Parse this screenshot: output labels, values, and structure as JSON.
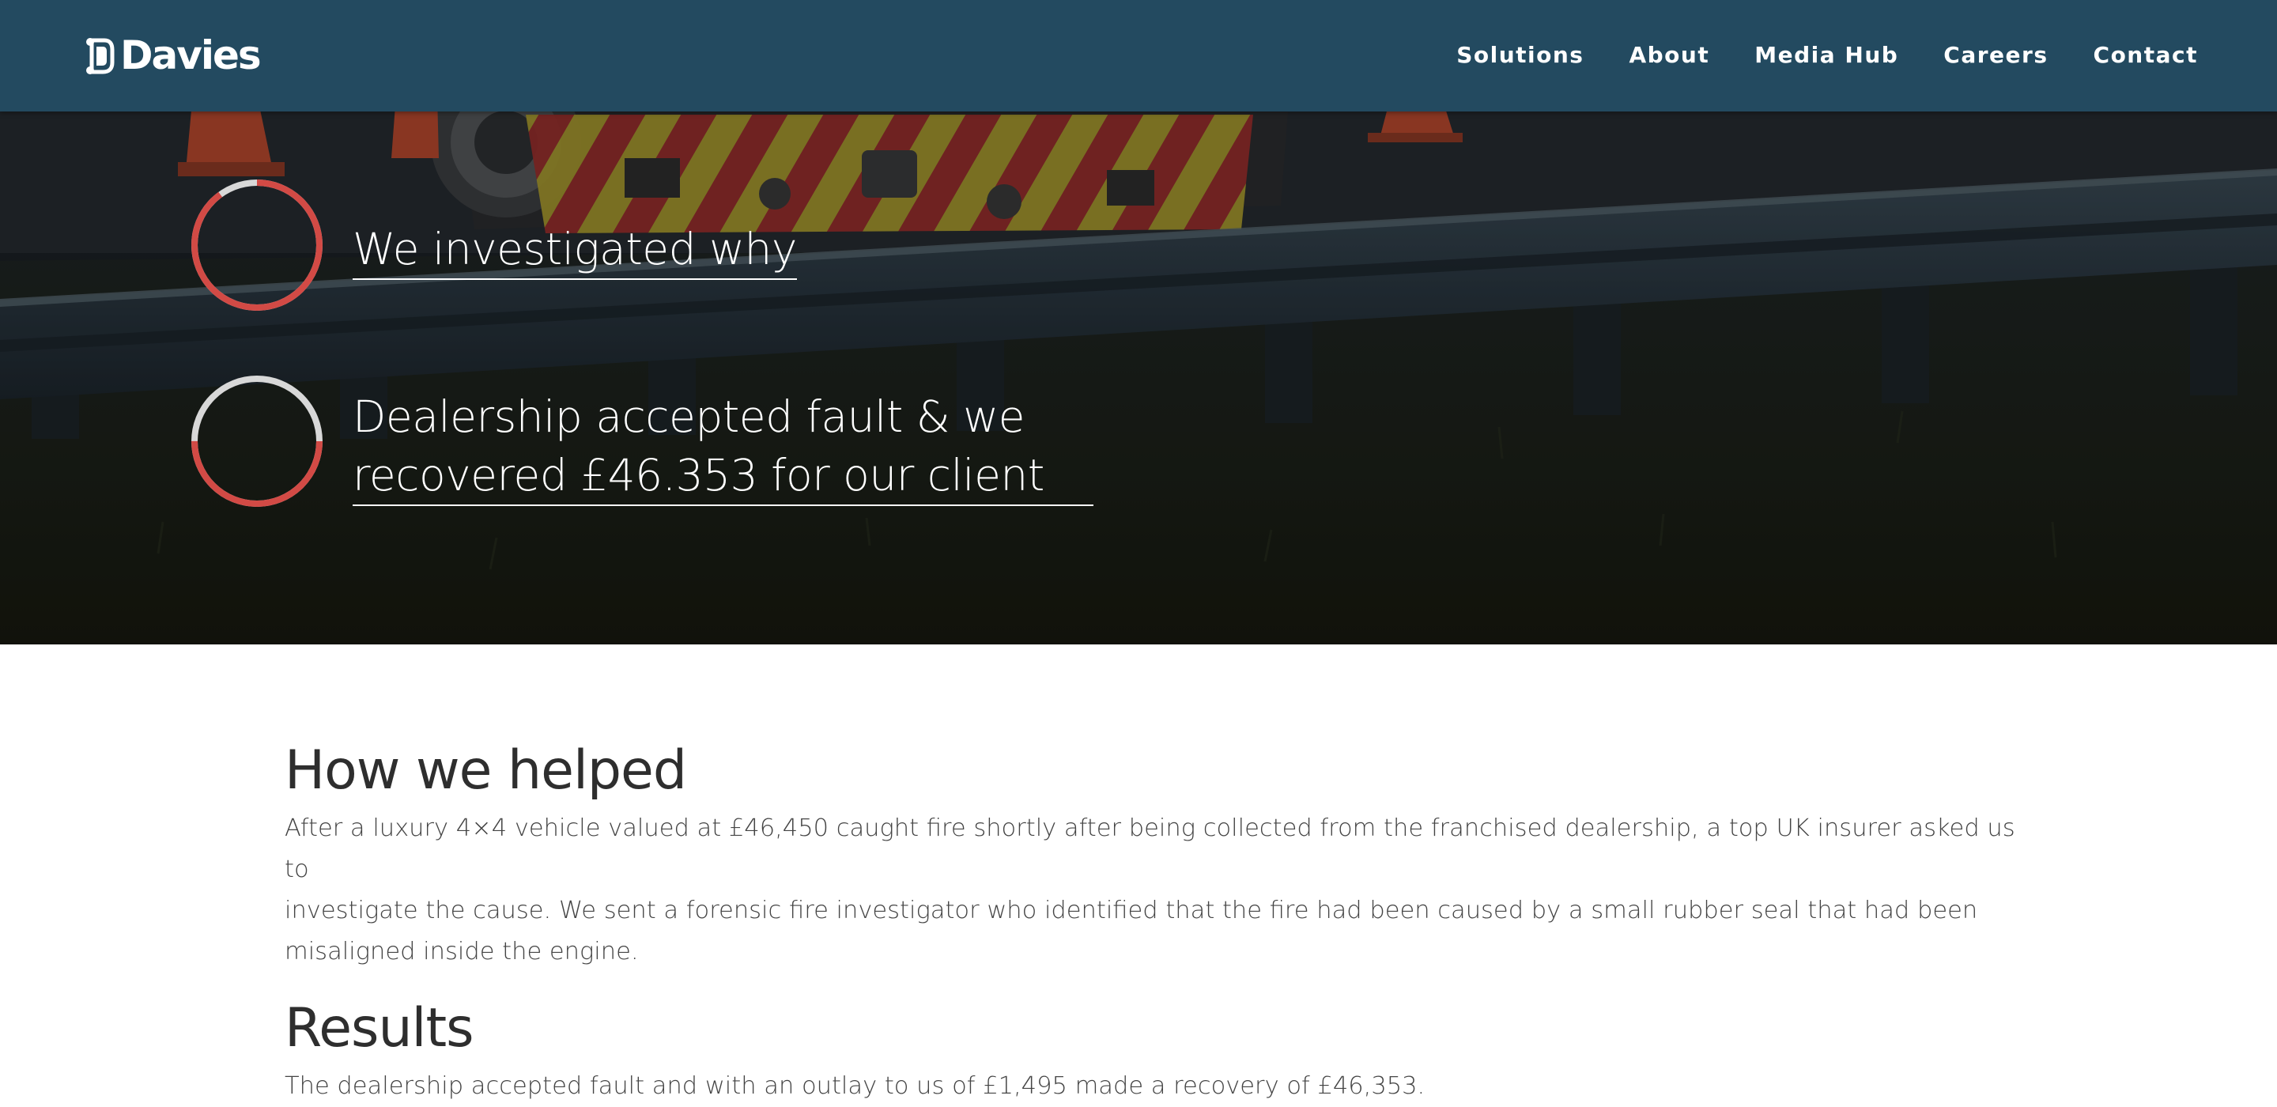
{
  "header": {
    "logo_text": "Davies",
    "nav": [
      "Solutions",
      "About",
      "Media Hub",
      "Careers",
      "Contact"
    ]
  },
  "steps": [
    {
      "text_lines": [
        "We investigated why"
      ],
      "progress": 0.9
    },
    {
      "text_lines": [
        "Dealership accepted fault & we",
        "recovered £46.353 for our client"
      ],
      "progress": 0.5
    }
  ],
  "colors": {
    "header_bg": "#234a60",
    "ring_accent": "#d24a45",
    "ring_track": "#d8d8d8",
    "heading": "#2e2e2e",
    "body_text": "#444444"
  },
  "sections": [
    {
      "heading": "How we helped",
      "lines": [
        "After a luxury 4×4 vehicle valued at £46,450 caught fire shortly after being collected from the franchised dealership, a top UK insurer asked us to",
        "investigate the cause. We sent a forensic fire investigator who identified that the fire had been caused by a small rubber seal that had been",
        "misaligned inside the engine."
      ]
    },
    {
      "heading": "Results",
      "lines": [
        "The dealership accepted fault and with an outlay to us of £1,495 made a recovery of £46,353."
      ]
    }
  ]
}
